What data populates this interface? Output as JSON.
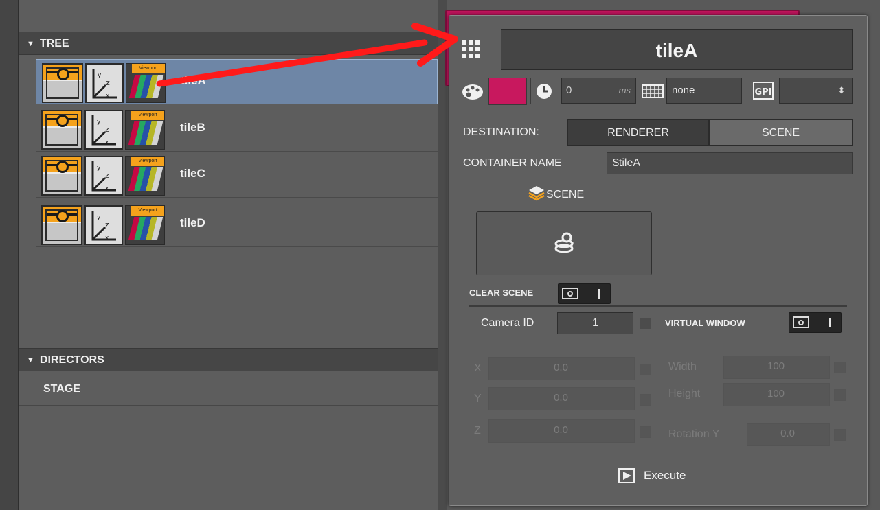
{
  "tree": {
    "section_title": "TREE",
    "items": [
      {
        "label": "tileA",
        "viewport_tag": "Viewport",
        "selected": true
      },
      {
        "label": "tileB",
        "viewport_tag": "Viewport",
        "selected": false
      },
      {
        "label": "tileC",
        "viewport_tag": "Viewport",
        "selected": false
      },
      {
        "label": "tileD",
        "viewport_tag": "Viewport",
        "selected": false
      }
    ]
  },
  "directors": {
    "section_title": "DIRECTORS",
    "items": [
      {
        "label": "STAGE"
      }
    ]
  },
  "popup": {
    "title": "tileA",
    "color": "#c8185e",
    "delay": {
      "value": "0",
      "unit": "ms"
    },
    "keyboard_value": "none",
    "gpi": {
      "label": "GPI",
      "value": ""
    },
    "destination": {
      "label": "DESTINATION:",
      "options": [
        "RENDERER",
        "SCENE"
      ],
      "selected": "RENDERER"
    },
    "container_name": {
      "label": "CONTAINER NAME",
      "value": "$tileA"
    },
    "scene": {
      "label": "SCENE"
    },
    "clear_scene": {
      "label": "CLEAR SCENE",
      "on": false
    },
    "camera_id": {
      "label": "Camera ID",
      "value": "1"
    },
    "virtual_window": {
      "label": "VIRTUAL WINDOW",
      "on": false
    },
    "coords": [
      {
        "label": "X",
        "value": "0.0"
      },
      {
        "label": "Y",
        "value": "0.0"
      },
      {
        "label": "Z",
        "value": "0.0"
      }
    ],
    "size": [
      {
        "label": "Width",
        "value": "100"
      },
      {
        "label": "Height",
        "value": "100"
      },
      {
        "label": "Rotation Y",
        "value": "0.0"
      }
    ],
    "execute_label": "Execute"
  },
  "colors": {
    "accent": "#c8185e",
    "selection": "#6e86a6",
    "annotation_arrow": "#ff1a1a",
    "link_orange": "#f5a21c"
  }
}
